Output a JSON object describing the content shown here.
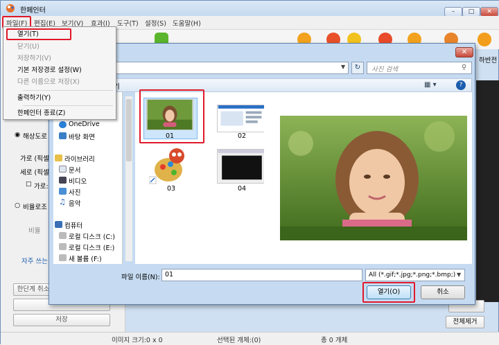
{
  "app": {
    "title": "한페인터"
  },
  "menubar": [
    "파일(F)",
    "편집(E)",
    "보기(V)",
    "효과(I)",
    "도구(T)",
    "설정(S)",
    "도움말(H)"
  ],
  "toolbar": {
    "right_label": "하반전"
  },
  "file_menu": {
    "items": [
      {
        "label": "열기(T)",
        "enabled": true
      },
      {
        "label": "닫기(U)",
        "enabled": false
      },
      {
        "label": "저장하기(V)",
        "enabled": false
      },
      {
        "label": "기본 저장경로 설정(W)",
        "enabled": true
      },
      {
        "label": "다른 이름으로 저장(X)",
        "enabled": false
      },
      {
        "label": "출력하기(Y)",
        "enabled": true
      },
      {
        "label": "한페인터 종료(Z)",
        "enabled": true
      }
    ]
  },
  "left_panel": {
    "resolution_label": "해상도로",
    "width_label": "가로 (픽셀",
    "height_label": "세로 (픽셀",
    "keep_ratio_label": "가로:",
    "ratio_label": "비율로조",
    "ratio_value_label": "비율",
    "favorites_label": "자주 쓰는",
    "undo_label": "한단계 취소",
    "save_label": "저장"
  },
  "dialog": {
    "address": "진",
    "search_placeholder": "사진 검색",
    "cmd_partial": "기",
    "nav": {
      "items": [
        "OneDrive",
        "바탕 화면",
        "라이브러리",
        "문서",
        "비디오",
        "사진",
        "음악",
        "컴퓨터",
        "로컬 디스크 (C:)",
        "로컬 디스크 (E:)",
        "새 볼륨 (F:)"
      ]
    },
    "files": [
      {
        "name": "01",
        "selected": true
      },
      {
        "name": "02",
        "selected": false
      },
      {
        "name": "03",
        "selected": false
      },
      {
        "name": "04",
        "selected": false
      }
    ],
    "filename_label": "파일 이름(N):",
    "filename_value": "01",
    "filter_value": "All (*.gif;*.jpg;*.png;*.bmp;)",
    "open_label": "열기(O)",
    "cancel_label": "취소"
  },
  "right_panel": {
    "remove_all_label": "전체제거"
  },
  "status": {
    "image_size": "이미지 크기:0 x 0",
    "selected": "선택된 개체:(0)",
    "total": "총 0 개체"
  },
  "colors": {
    "highlight": "#e0182a",
    "dialog_bg": "#c6dbf1",
    "accent": "#1b5cad"
  }
}
